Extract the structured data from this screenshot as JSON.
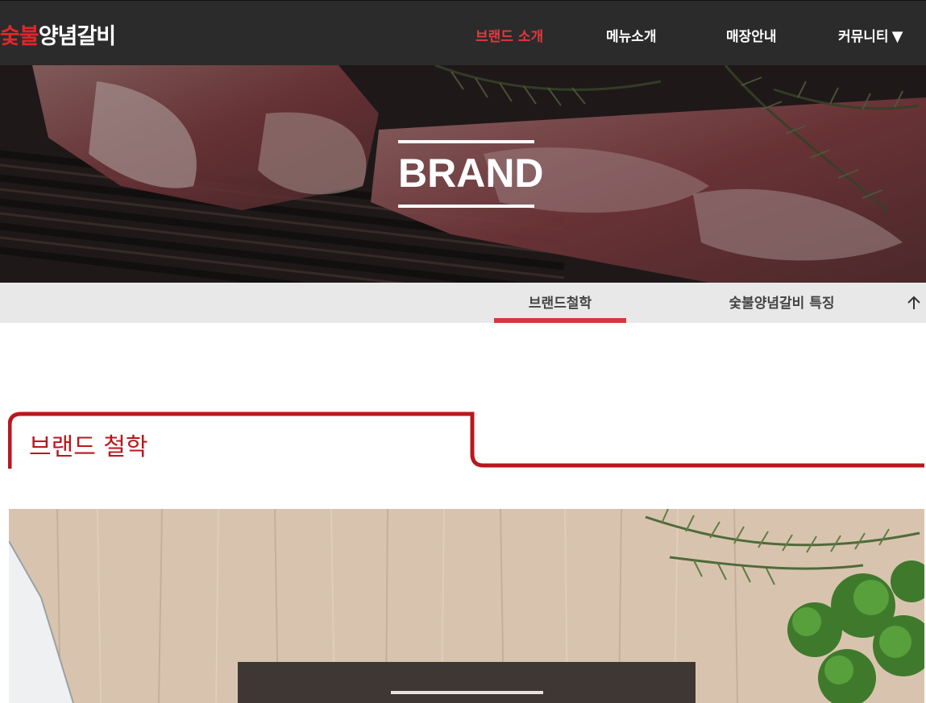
{
  "header": {
    "logo": {
      "part1": "숯불",
      "part2": "양념갈비"
    },
    "nav": [
      {
        "label": "브랜드 소개",
        "active": true
      },
      {
        "label": "메뉴소개",
        "active": false
      },
      {
        "label": "매장안내",
        "active": false
      },
      {
        "label": "커뮤니티",
        "active": false,
        "suffix": "▼"
      }
    ]
  },
  "hero": {
    "title": "BRAND"
  },
  "subnav": {
    "tabs": [
      {
        "label": "브랜드철학",
        "active": true
      },
      {
        "label": "숯불양념갈비 특징",
        "active": false
      }
    ],
    "scroll_top_icon": "arrow-up-icon"
  },
  "section": {
    "title": "브랜드 철학"
  },
  "colors": {
    "header_bg": "#2b2b2b",
    "accent_red": "#e2393e",
    "section_red": "#b8181d",
    "subnav_bg": "#e8e8e8"
  }
}
